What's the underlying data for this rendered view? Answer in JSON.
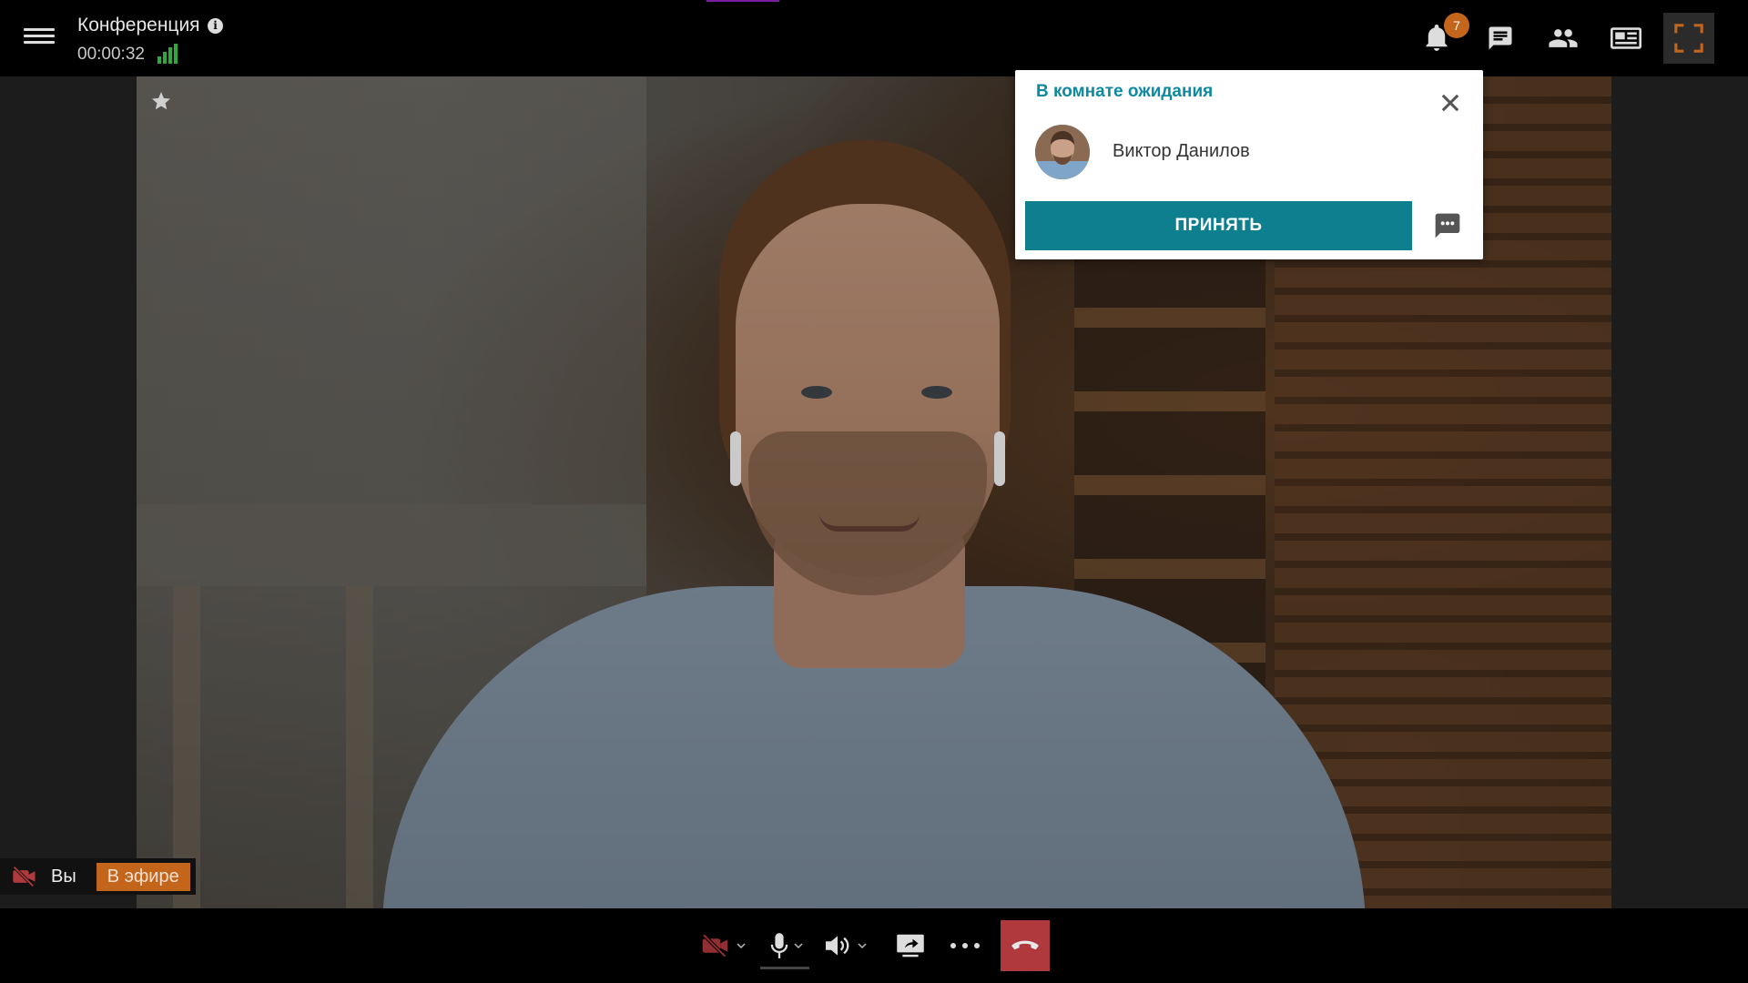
{
  "header": {
    "title": "Конференция",
    "timer": "00:00:32",
    "notifications_count": "7"
  },
  "icons": {
    "menu": "hamburger-menu-icon",
    "info": "info-icon",
    "signal": "signal-strength-icon",
    "notifications": "bell-icon",
    "chat": "chat-icon",
    "participants": "people-icon",
    "layout": "presentation-layout-icon",
    "fullscreen": "fullscreen-icon"
  },
  "colors": {
    "accent_teal": "#0e7f8e",
    "title_teal": "#0e8aa0",
    "badge_orange": "#c4651c",
    "hangup_red": "#b0393d",
    "signal_green": "#2eaa3c"
  },
  "waiting_room": {
    "title": "В комнате ожидания",
    "participant_name": "Виктор Данилов",
    "accept_label": "ПРИНЯТЬ"
  },
  "self_view": {
    "label": "Вы",
    "status": "В эфире"
  }
}
